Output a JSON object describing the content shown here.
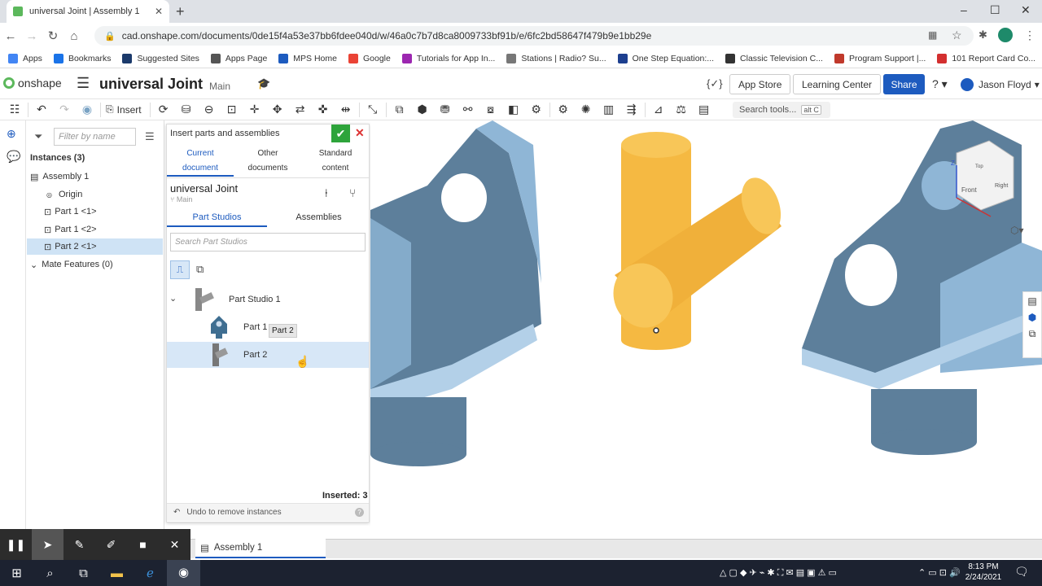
{
  "browser": {
    "tab_title": "universal Joint | Assembly 1",
    "url": "cad.onshape.com/documents/0de15f4a53e37bb6fdee040d/w/46a0c7b7d8ca8009733bf91b/e/6fc2bd58647f479b9e1bb29e",
    "bookmarks": [
      {
        "label": "Apps",
        "color": "#4285f4"
      },
      {
        "label": "Bookmarks",
        "color": "#1a73e8"
      },
      {
        "label": "Suggested Sites",
        "color": "#1b3a6b"
      },
      {
        "label": "Apps Page",
        "color": "#555555"
      },
      {
        "label": "MPS Home",
        "color": "#1d5bbf"
      },
      {
        "label": "Google",
        "color": "#ea4335"
      },
      {
        "label": "Tutorials for App In...",
        "color": "#9c27b0"
      },
      {
        "label": "Stations | Radio? Su...",
        "color": "#777777"
      },
      {
        "label": "One Step Equation:...",
        "color": "#1d3f8f"
      },
      {
        "label": "Classic Television C...",
        "color": "#333333"
      },
      {
        "label": "Program Support |...",
        "color": "#c0392b"
      },
      {
        "label": "101 Report Card Co...",
        "color": "#d32f2f"
      }
    ]
  },
  "header": {
    "logo": "onshape",
    "doc_title": "universal Joint",
    "branch": "Main",
    "app_store": "App Store",
    "learning_center": "Learning Center",
    "share": "Share",
    "user": "Jason Floyd"
  },
  "toolbar": {
    "insert_label": "Insert",
    "search_tools": "Search tools...",
    "search_shortcut": "alt C"
  },
  "instances": {
    "filter_placeholder": "Filter by name",
    "header": "Instances (3)",
    "items": [
      {
        "label": "Assembly 1"
      },
      {
        "label": "Origin"
      },
      {
        "label": "Part 1 <1>"
      },
      {
        "label": "Part 1 <2>"
      },
      {
        "label": "Part 2 <1>"
      },
      {
        "label": "Mate Features (0)"
      }
    ]
  },
  "dialog": {
    "title": "Insert parts and assemblies",
    "tabs": [
      "Current document",
      "Other documents",
      "Standard content"
    ],
    "tab_lines": [
      [
        "Current",
        "document"
      ],
      [
        "Other",
        "documents"
      ],
      [
        "Standard",
        "content"
      ]
    ],
    "doc_name": "universal Joint",
    "doc_branch": "Main",
    "sub_tabs": [
      "Part Studios",
      "Assemblies"
    ],
    "search_placeholder": "Search Part Studios",
    "part_studio": "Part Studio 1",
    "parts": [
      "Part 1",
      "Part 2"
    ],
    "tooltip": "Part 2",
    "inserted": "Inserted: 3",
    "undo": "Undo to remove instances"
  },
  "viewcube": {
    "top": "Top",
    "front": "Front",
    "right": "Right",
    "z": "Z"
  },
  "bottom": {
    "tab": "Assembly 1"
  },
  "taskbar": {
    "time": "8:13 PM",
    "date": "2/24/2021"
  },
  "colors": {
    "part_blue": "#7aa3c4",
    "part_yellow": "#f5b942",
    "accent": "#1d5bbf",
    "ok_green": "#2ea43b"
  }
}
